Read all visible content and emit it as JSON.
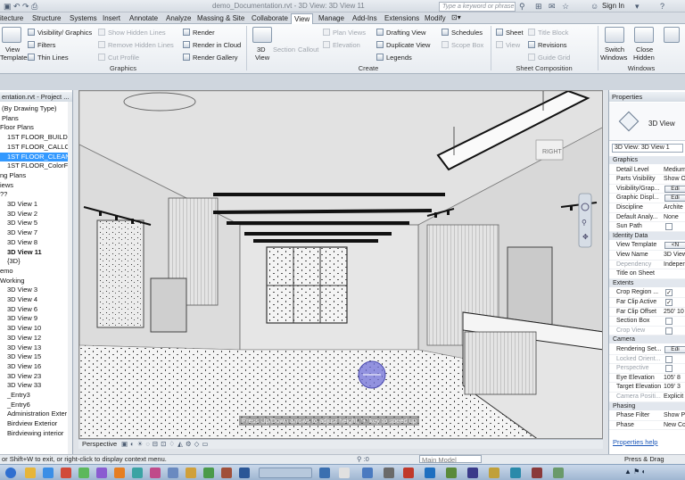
{
  "titlebar": {
    "document": "demo_Documentation.rvt - 3D View: 3D View 11",
    "search_placeholder": "Type a keyword or phrase",
    "signin": "Sign In"
  },
  "tabs": [
    "itecture",
    "Structure",
    "Systems",
    "Insert",
    "Annotate",
    "Analyze",
    "Massing & Site",
    "Collaborate",
    "View",
    "Manage",
    "Add-Ins",
    "Extensions",
    "Modify"
  ],
  "ribbon": {
    "templates": {
      "line1": "View",
      "line2": "Templates"
    },
    "vis": "Visibility/ Graphics",
    "filters": "Filters",
    "thin": "Thin Lines",
    "show_hidden": "Show Hidden Lines",
    "remove_hidden": "Remove Hidden Lines",
    "cut_profile": "Cut Profile",
    "render": "Render",
    "render_cloud": "Render in Cloud",
    "render_gallery": "Render Gallery",
    "view3d": {
      "line1": "3D",
      "line2": "View"
    },
    "section": "Section",
    "callout": "Callout",
    "plan_views": "Plan Views",
    "elevation": "Elevation",
    "drafting": "Drafting View",
    "duplicate": "Duplicate View",
    "legends": "Legends",
    "schedules": "Schedules",
    "scope_box": "Scope Box",
    "sheet": "Sheet",
    "view_btn": "View",
    "title_block": "Title Block",
    "revisions": "Revisions",
    "guide_grid": "Guide Grid",
    "switch": {
      "line1": "Switch",
      "line2": "Windows"
    },
    "close_hidden": {
      "line1": "Close",
      "line2": "Hidden"
    },
    "panels": {
      "graphics": "Graphics",
      "create": "Create",
      "sheet_comp": "Sheet Composition",
      "windows": "Windows"
    }
  },
  "browser": {
    "title": "entation.rvt - Project ...",
    "items": [
      {
        "label": "(By Drawing Type)",
        "indent": 2,
        "style": ""
      },
      {
        "label": "Plans",
        "indent": 2,
        "style": ""
      },
      {
        "label": "Floor Plans",
        "indent": 0,
        "style": ""
      },
      {
        "label": "1ST FLOOR_BUILDIN",
        "indent": 8,
        "style": ""
      },
      {
        "label": "1ST FLOOR_CALLOU",
        "indent": 8,
        "style": ""
      },
      {
        "label": "1ST FLOOR_CLEAN",
        "indent": 8,
        "style": "sel"
      },
      {
        "label": "1ST FLOOR_ColorFil",
        "indent": 8,
        "style": ""
      },
      {
        "label": "ng Plans",
        "indent": 0,
        "style": ""
      },
      {
        "label": "iews",
        "indent": 0,
        "style": ""
      },
      {
        "label": "??",
        "indent": 0,
        "style": ""
      },
      {
        "label": "3D View 1",
        "indent": 8,
        "style": ""
      },
      {
        "label": "3D View 2",
        "indent": 8,
        "style": ""
      },
      {
        "label": "3D View 5",
        "indent": 8,
        "style": ""
      },
      {
        "label": "3D View 7",
        "indent": 8,
        "style": ""
      },
      {
        "label": "3D View 8",
        "indent": 8,
        "style": ""
      },
      {
        "label": "3D View 11",
        "indent": 8,
        "style": "bold"
      },
      {
        "label": "{3D}",
        "indent": 8,
        "style": ""
      },
      {
        "label": "emo",
        "indent": 0,
        "style": ""
      },
      {
        "label": "Working",
        "indent": 0,
        "style": ""
      },
      {
        "label": "3D View 3",
        "indent": 8,
        "style": ""
      },
      {
        "label": "3D View 4",
        "indent": 8,
        "style": ""
      },
      {
        "label": "3D View 6",
        "indent": 8,
        "style": ""
      },
      {
        "label": "3D View 9",
        "indent": 8,
        "style": ""
      },
      {
        "label": "3D View 10",
        "indent": 8,
        "style": ""
      },
      {
        "label": "3D View 12",
        "indent": 8,
        "style": ""
      },
      {
        "label": "3D View 13",
        "indent": 8,
        "style": ""
      },
      {
        "label": "3D View 15",
        "indent": 8,
        "style": ""
      },
      {
        "label": "3D View 16",
        "indent": 8,
        "style": ""
      },
      {
        "label": "3D View 23",
        "indent": 8,
        "style": ""
      },
      {
        "label": "3D View 33",
        "indent": 8,
        "style": ""
      },
      {
        "label": "_Entry3",
        "indent": 8,
        "style": ""
      },
      {
        "label": "_Entry6",
        "indent": 8,
        "style": ""
      },
      {
        "label": "Administration Exter",
        "indent": 8,
        "style": ""
      },
      {
        "label": "Birdview Exterior",
        "indent": 8,
        "style": ""
      },
      {
        "label": "Birdviewing interior",
        "indent": 8,
        "style": ""
      }
    ]
  },
  "viewport": {
    "hint": "Press Up/Down arrows to adjust height, '+' key to speed up",
    "scale_label": "Perspective",
    "sign": "RIGHT"
  },
  "properties": {
    "title": "Properties",
    "type_name": "3D View",
    "selector": "3D View: 3D View 1",
    "rows": [
      {
        "kind": "grp",
        "k": "Graphics"
      },
      {
        "kind": "row",
        "k": "Detail Level",
        "v": "Medium"
      },
      {
        "kind": "row",
        "k": "Parts Visibility",
        "v": "Show Or"
      },
      {
        "kind": "btn",
        "k": "Visibility/Grap...",
        "v": "Edi"
      },
      {
        "kind": "btn",
        "k": "Graphic Displ...",
        "v": "Edi"
      },
      {
        "kind": "row",
        "k": "Discipline",
        "v": "Archite"
      },
      {
        "kind": "row",
        "k": "Default Analy...",
        "v": "None"
      },
      {
        "kind": "chk",
        "k": "Sun Path",
        "v": ""
      },
      {
        "kind": "grp",
        "k": "Identity Data"
      },
      {
        "kind": "btn",
        "k": "View Template",
        "v": "<N"
      },
      {
        "kind": "row",
        "k": "View Name",
        "v": "3D View"
      },
      {
        "kind": "dis",
        "k": "Dependency",
        "v": "Indepen"
      },
      {
        "kind": "row",
        "k": "Title on Sheet",
        "v": ""
      },
      {
        "kind": "grp",
        "k": "Extents"
      },
      {
        "kind": "chk",
        "k": "Crop Region ...",
        "v": "✓"
      },
      {
        "kind": "chk",
        "k": "Far Clip Active",
        "v": "✓"
      },
      {
        "kind": "row",
        "k": "Far Clip Offset",
        "v": "250' 10"
      },
      {
        "kind": "chk",
        "k": "Section Box",
        "v": ""
      },
      {
        "kind": "chkdis",
        "k": "Crop View",
        "v": ""
      },
      {
        "kind": "grp",
        "k": "Camera"
      },
      {
        "kind": "btn",
        "k": "Rendering Set...",
        "v": "Edi"
      },
      {
        "kind": "chkdis",
        "k": "Locked Orient...",
        "v": ""
      },
      {
        "kind": "chkdis",
        "k": "Perspective",
        "v": ""
      },
      {
        "kind": "row",
        "k": "Eye Elevation",
        "v": "105' 8"
      },
      {
        "kind": "row",
        "k": "Target Elevation",
        "v": "109' 3"
      },
      {
        "kind": "dis",
        "k": "Camera Positi...",
        "v": "Explicit"
      },
      {
        "kind": "grp",
        "k": "Phasing"
      },
      {
        "kind": "row",
        "k": "Phase Filter",
        "v": "Show P"
      },
      {
        "kind": "row",
        "k": "Phase",
        "v": "New Co"
      }
    ],
    "help": "Properties help"
  },
  "status": {
    "left": "or Shift+W to exit, or right-click to display context menu.",
    "model": "Main Model",
    "press_drag": "Press & Drag"
  },
  "colors": {
    "accent": "#3399ff",
    "link": "#1a56b8"
  }
}
